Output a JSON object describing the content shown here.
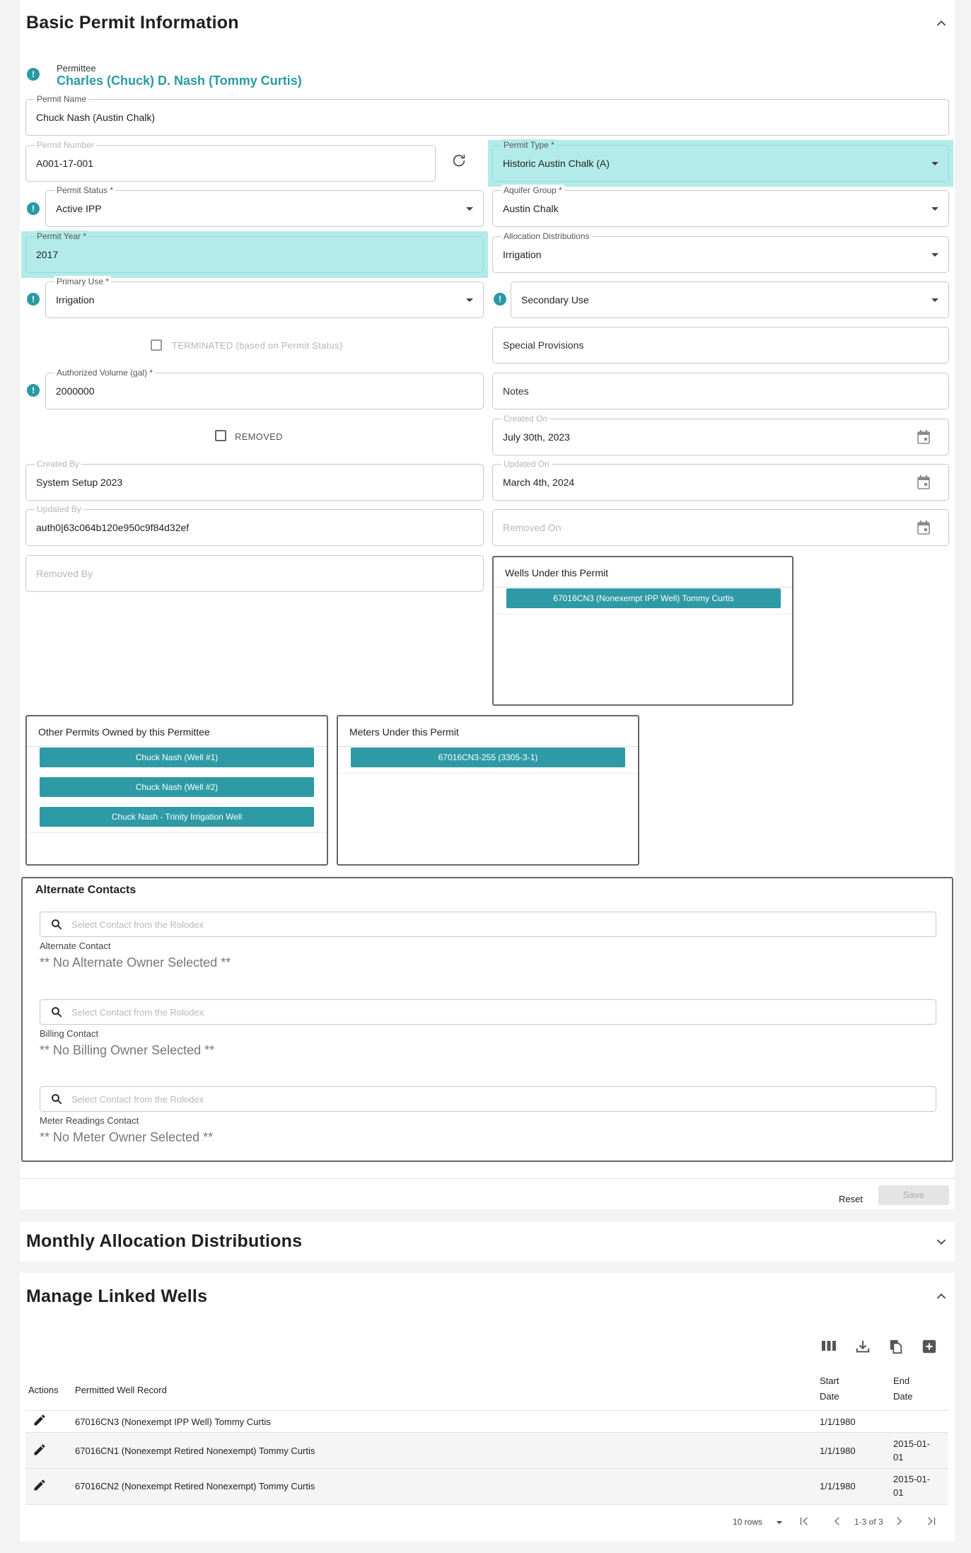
{
  "basic": {
    "title": "Basic Permit Information",
    "permittee_label": "Permittee",
    "permittee_name": "Charles (Chuck) D. Nash (Tommy Curtis)",
    "permit_name": {
      "label": "Permit Name",
      "value": "Chuck Nash (Austin Chalk)"
    },
    "permit_number": {
      "label": "Permit Number",
      "value": "A001-17-001"
    },
    "permit_type": {
      "label": "Permit Type *",
      "value": "Historic Austin Chalk (A)"
    },
    "permit_status": {
      "label": "Permit Status *",
      "value": "Active IPP"
    },
    "aquifer_group": {
      "label": "Aquifer Group *",
      "value": "Austin Chalk"
    },
    "permit_year": {
      "label": "Permit Year *",
      "value": "2017"
    },
    "allocation_distributions": {
      "label": "Allocation Distributions",
      "value": "Irrigation"
    },
    "primary_use": {
      "label": "Primary Use *",
      "value": "Irrigation"
    },
    "secondary_use": {
      "placeholder": "Secondary Use"
    },
    "terminated_label": "TERMINATED (based on Permit Status)",
    "special_provisions": {
      "placeholder": "Special Provisions"
    },
    "authorized_volume": {
      "label": "Authorized Volume (gal) *",
      "value": "2000000"
    },
    "notes": {
      "placeholder": "Notes"
    },
    "removed_label": "REMOVED",
    "created_on": {
      "label": "Created On",
      "value": "July 30th, 2023"
    },
    "created_by": {
      "label": "Created By",
      "value": "System Setup 2023"
    },
    "updated_on": {
      "label": "Updated On",
      "value": "March 4th, 2024"
    },
    "updated_by": {
      "label": "Updated By",
      "value": "auth0|63c064b120e950c9f84d32ef"
    },
    "removed_on": {
      "placeholder": "Removed On"
    },
    "removed_by": {
      "placeholder": "Removed By"
    }
  },
  "wells_box": {
    "title": "Wells Under this Permit",
    "items": [
      "67016CN3 (Nonexempt IPP Well) Tommy Curtis"
    ]
  },
  "other_permits_box": {
    "title": "Other Permits Owned by this Permittee",
    "items": [
      "Chuck Nash (Well #1)",
      "Chuck Nash (Well #2)",
      "Chuck Nash - Trinity Irrigation Well"
    ]
  },
  "meters_box": {
    "title": "Meters Under this Permit",
    "items": [
      "67016CN3-255 (3305-3-1)"
    ]
  },
  "alt_contacts": {
    "title": "Alternate Contacts",
    "search_placeholder": "Select Contact from the Rolodex",
    "groups": [
      {
        "label": "Alternate Contact",
        "value": "** No Alternate Owner Selected **"
      },
      {
        "label": "Billing Contact",
        "value": "** No Billing Owner Selected **"
      },
      {
        "label": "Meter Readings Contact",
        "value": "** No Meter Owner Selected **"
      }
    ]
  },
  "actions": {
    "reset": "Reset",
    "save": "Save"
  },
  "monthly": {
    "title": "Monthly Allocation Distributions"
  },
  "linked": {
    "title": "Manage Linked Wells",
    "columns": {
      "actions": "Actions",
      "record": "Permitted Well Record",
      "start_1": "Start",
      "start_2": "Date",
      "end_1": "End",
      "end_2": "Date"
    },
    "rows": [
      {
        "record": "67016CN3 (Nonexempt IPP Well) Tommy Curtis",
        "start": "1/1/1980",
        "end_1": "",
        "end_2": ""
      },
      {
        "record": "67016CN1 (Nonexempt Retired Nonexempt) Tommy Curtis",
        "start": "1/1/1980",
        "end_1": "2015-01-",
        "end_2": "01"
      },
      {
        "record": "67016CN2 (Nonexempt Retired Nonexempt) Tommy Curtis",
        "start": "1/1/1980",
        "end_1": "2015-01-",
        "end_2": "01"
      }
    ],
    "pagination": {
      "rows_per_page": "10 rows",
      "range": "1-3 of 3"
    }
  }
}
